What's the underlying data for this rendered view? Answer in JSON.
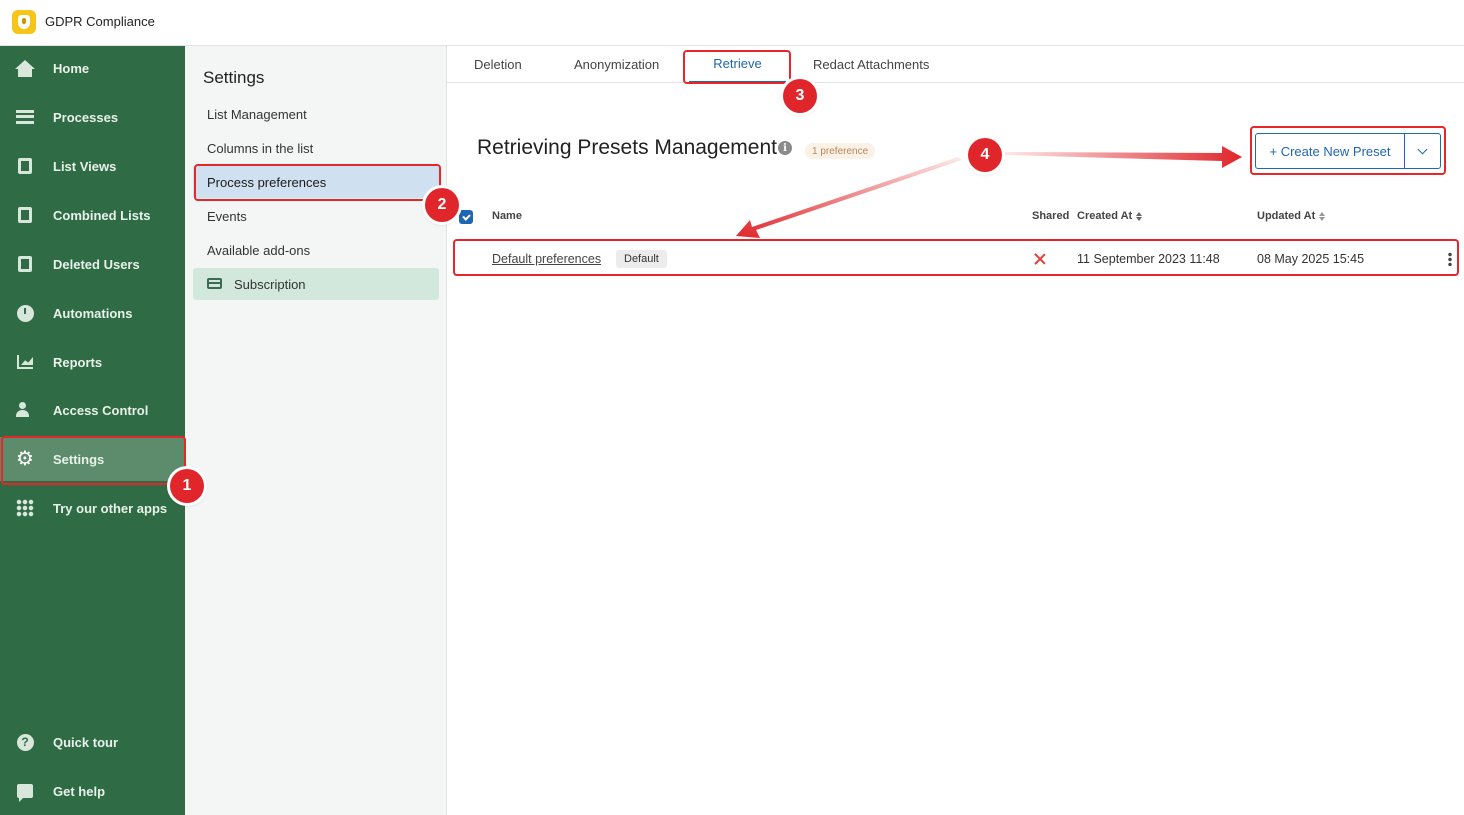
{
  "app": {
    "title": "GDPR Compliance"
  },
  "nav": {
    "items": [
      {
        "label": "Home",
        "icon": "home-icon"
      },
      {
        "label": "Processes",
        "icon": "processes-icon"
      },
      {
        "label": "List Views",
        "icon": "list-views-icon"
      },
      {
        "label": "Combined Lists",
        "icon": "combined-lists-icon"
      },
      {
        "label": "Deleted Users",
        "icon": "deleted-users-icon"
      },
      {
        "label": "Automations",
        "icon": "clock-icon"
      },
      {
        "label": "Reports",
        "icon": "chart-icon"
      },
      {
        "label": "Access Control",
        "icon": "user-lock-icon"
      },
      {
        "label": "Settings",
        "icon": "gear-icon"
      },
      {
        "label": "Try our other apps",
        "icon": "apps-grid-icon"
      }
    ],
    "bottom": [
      {
        "label": "Quick tour",
        "icon": "help-icon"
      },
      {
        "label": "Get help",
        "icon": "chat-icon"
      }
    ]
  },
  "settings": {
    "title": "Settings",
    "items": [
      {
        "label": "List Management"
      },
      {
        "label": "Columns in the list"
      },
      {
        "label": "Process preferences"
      },
      {
        "label": "Events"
      },
      {
        "label": "Available add-ons"
      },
      {
        "label": "Subscription"
      }
    ]
  },
  "tabs": [
    {
      "label": "Deletion"
    },
    {
      "label": "Anonymization"
    },
    {
      "label": "Retrieve"
    },
    {
      "label": "Redact Attachments"
    }
  ],
  "main": {
    "title": "Retrieving Presets Management",
    "info": "i",
    "count_badge": "1 preference",
    "create_button": "+ Create New Preset"
  },
  "table": {
    "headers": {
      "name": "Name",
      "shared": "Shared",
      "created": "Created At",
      "updated": "Updated At"
    },
    "rows": [
      {
        "name": "Default preferences",
        "badge": "Default",
        "shared": false,
        "created": "11 September 2023 11:48",
        "updated": "08 May 2025 15:45"
      }
    ]
  },
  "annotations": {
    "n1": "1",
    "n2": "2",
    "n3": "3",
    "n4": "4"
  },
  "colors": {
    "nav_bg": "#2f6b45",
    "accent": "#1f66b3",
    "annotation": "#e0262a"
  }
}
